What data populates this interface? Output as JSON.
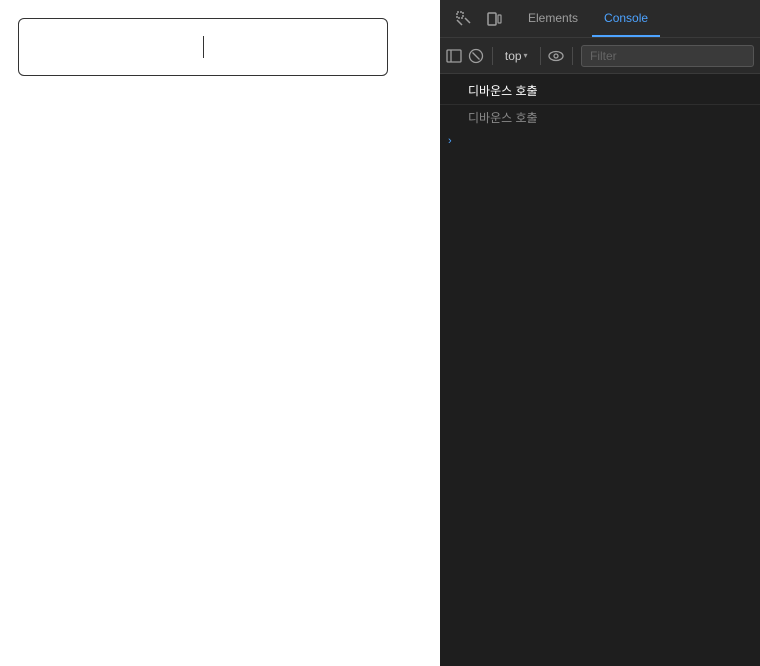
{
  "mainPanel": {
    "background": "#ffffff"
  },
  "devtools": {
    "tabs": [
      {
        "id": "elements",
        "label": "Elements",
        "active": false
      },
      {
        "id": "console",
        "label": "Console",
        "active": true
      }
    ],
    "consoleToolbar": {
      "topLabel": "top",
      "filterPlaceholder": "Filter"
    },
    "consoleEntries": [
      {
        "id": "entry1",
        "text": "디바운스 호출",
        "type": "white"
      },
      {
        "id": "entry2",
        "text": "디바운스 호출",
        "type": "gray"
      }
    ],
    "expandEntry": {
      "arrow": "›"
    }
  }
}
